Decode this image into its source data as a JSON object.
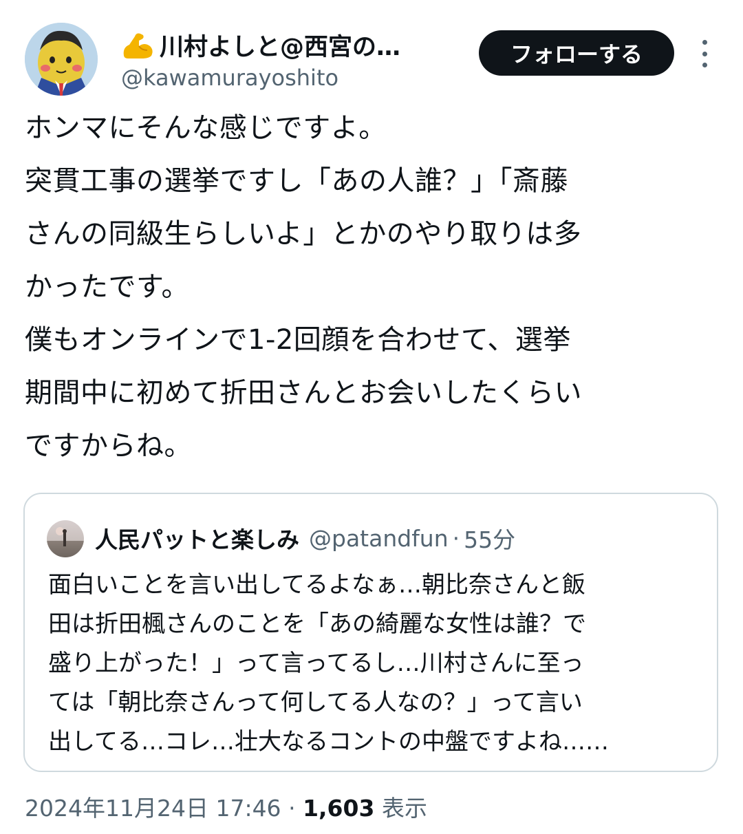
{
  "author": {
    "name": "川村よしと@西宮の…",
    "handle": "@kawamurayoshito",
    "follow_label": "フォローする"
  },
  "tweet": {
    "lines": [
      "ホンマにそんな感じですよ。",
      "突貫工事の選挙ですし「あの人誰？」「斎藤",
      "さんの同級生らしいよ」とかのやり取りは多",
      "かったです。",
      "僕もオンラインで1-2回顔を合わせて、選挙",
      "期間中に初めて折田さんとお会いしたくらい",
      "ですからね。"
    ]
  },
  "quote": {
    "name": "人民パットと楽しみ",
    "handle": "@patandfun",
    "separator": "·",
    "time": "55分",
    "lines": [
      "面白いことを言い出してるよなぁ…朝比奈さんと飯",
      "田は折田楓さんのことを「あの綺麗な女性は誰？で",
      "盛り上がった！」って言ってるし…川村さんに至っ",
      "ては「朝比奈さんって何してる人なの？」って言い",
      "出してる…コレ…壮大なるコントの中盤ですよね……"
    ]
  },
  "meta": {
    "datetime": "2024年11月24日 17:46",
    "separator": "·",
    "views": "1,603",
    "views_label": "表示"
  }
}
